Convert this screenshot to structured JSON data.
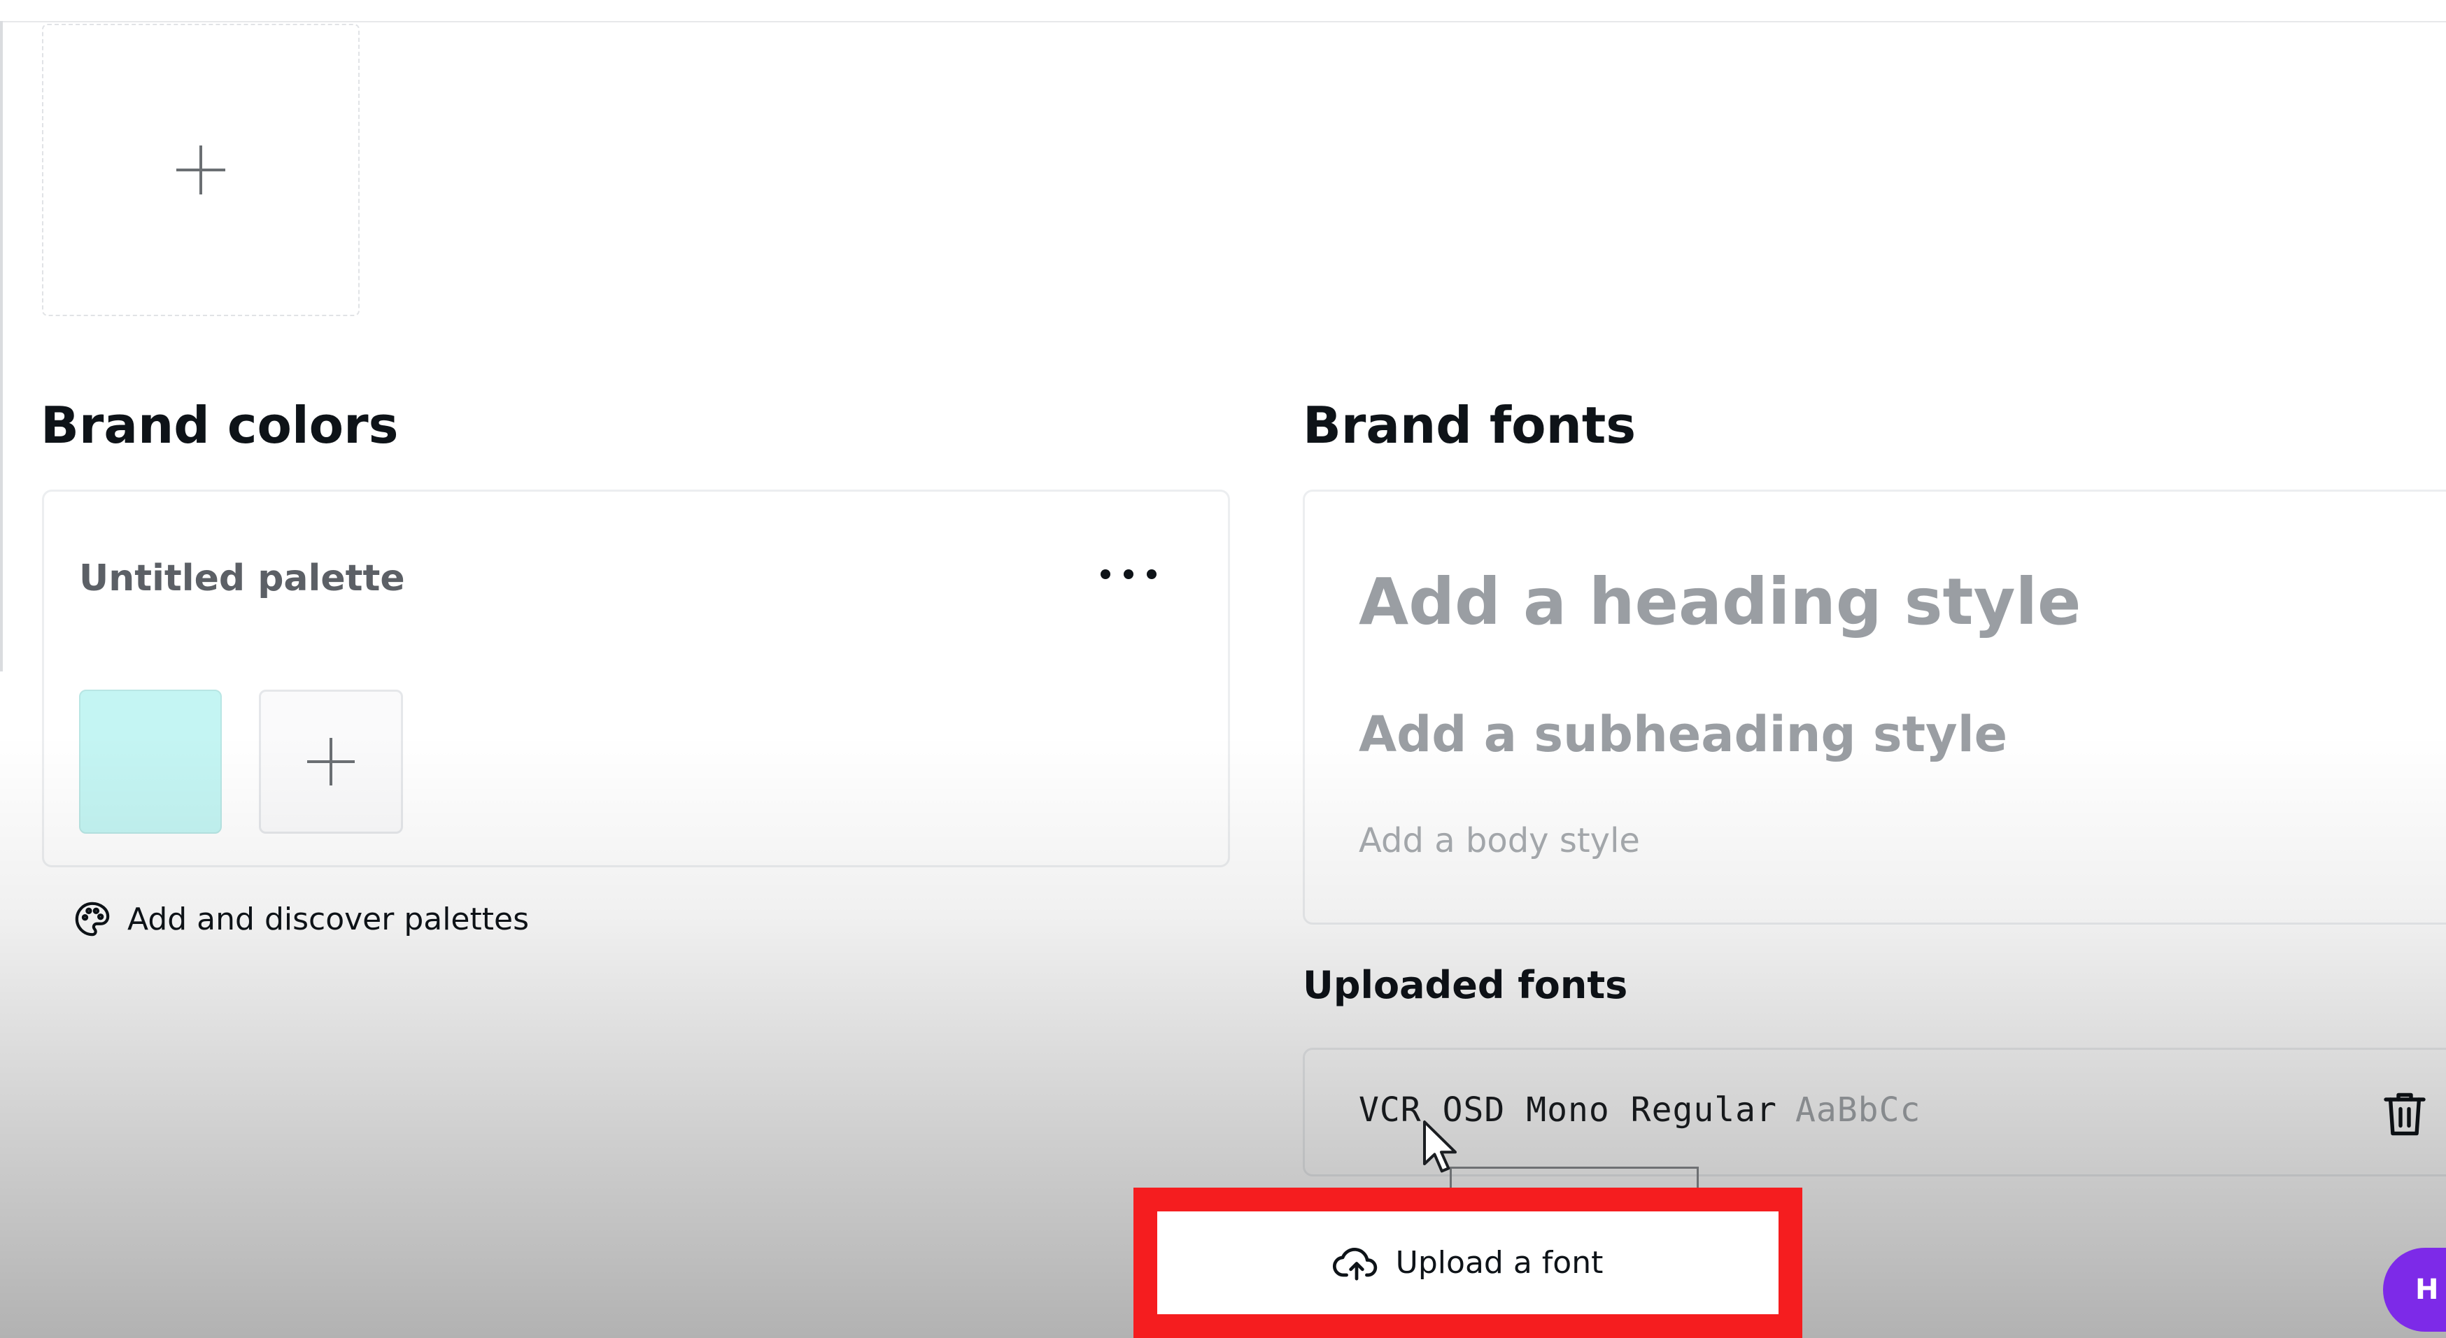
{
  "brand_colors": {
    "title": "Brand colors",
    "palette": {
      "name": "Untitled palette",
      "swatches": [
        "#C4F5F3"
      ]
    },
    "discover_link": "Add and discover palettes"
  },
  "brand_fonts": {
    "title": "Brand fonts",
    "heading_placeholder": "Add a heading style",
    "subheading_placeholder": "Add a subheading style",
    "body_placeholder": "Add a body style"
  },
  "uploaded_fonts": {
    "title": "Uploaded fonts",
    "fonts": [
      {
        "name": "VCR OSD Mono Regular",
        "sample": "AaBbCc"
      }
    ],
    "upload_button": "Upload a font"
  },
  "help_button": {
    "label": "H"
  },
  "colors": {
    "highlight": "#F51D1F",
    "help_purple": "#7D2AE8",
    "swatch": "#C4F5F3"
  }
}
